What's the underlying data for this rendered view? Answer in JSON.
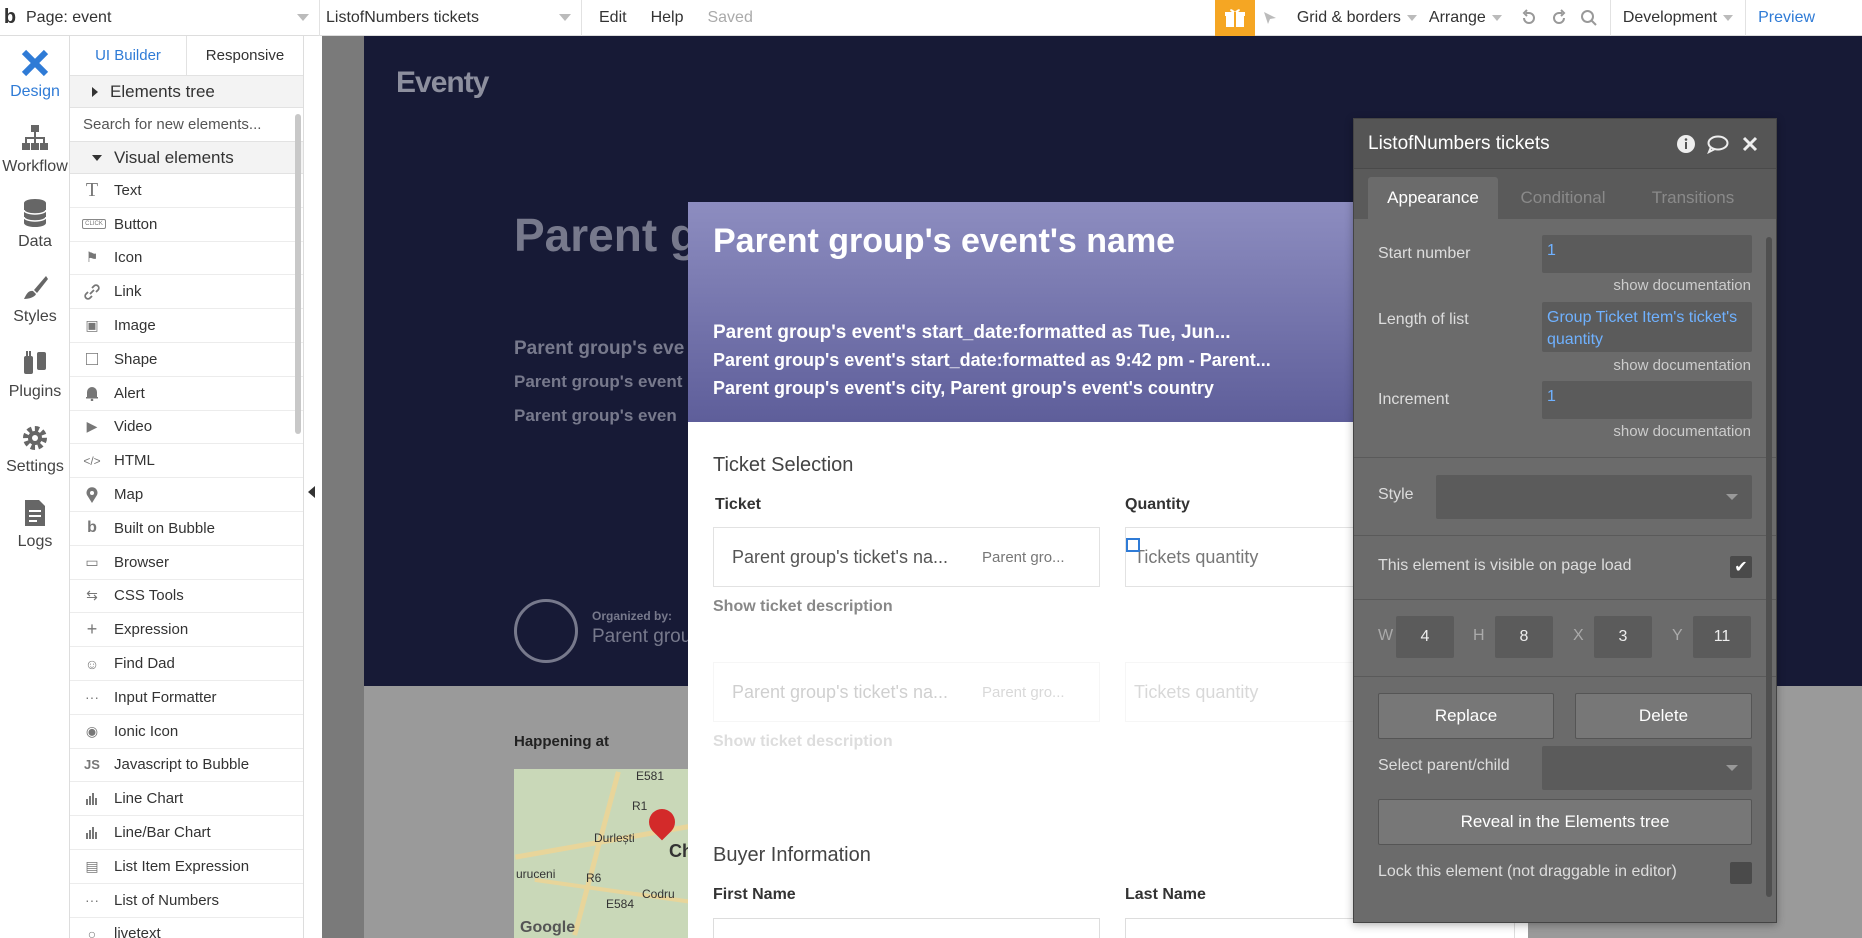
{
  "topbar": {
    "logo": "b",
    "page_select": "Page: event",
    "element_select": "ListofNumbers tickets",
    "edit": "Edit",
    "help": "Help",
    "saved": "Saved",
    "grid": "Grid & borders",
    "arrange": "Arrange",
    "environment": "Development",
    "preview": "Preview"
  },
  "leftnav": {
    "items": [
      {
        "label": "Design"
      },
      {
        "label": "Workflow"
      },
      {
        "label": "Data"
      },
      {
        "label": "Styles"
      },
      {
        "label": "Plugins"
      },
      {
        "label": "Settings"
      },
      {
        "label": "Logs"
      }
    ]
  },
  "elements_panel": {
    "tab_builder": "UI Builder",
    "tab_responsive": "Responsive",
    "tree_label": "Elements tree",
    "search_placeholder": "Search for new elements...",
    "visual_label": "Visual elements",
    "items": [
      {
        "label": "Text",
        "icon": "T"
      },
      {
        "label": "Button",
        "icon": "CLICK"
      },
      {
        "label": "Icon",
        "icon": "⚑"
      },
      {
        "label": "Link",
        "icon": "🔗"
      },
      {
        "label": "Image",
        "icon": "▣"
      },
      {
        "label": "Shape",
        "icon": "□"
      },
      {
        "label": "Alert",
        "icon": "🔔"
      },
      {
        "label": "Video",
        "icon": "▶"
      },
      {
        "label": "HTML",
        "icon": "</>"
      },
      {
        "label": "Map",
        "icon": "📍"
      },
      {
        "label": "Built on Bubble",
        "icon": "b"
      },
      {
        "label": "Browser",
        "icon": "▭"
      },
      {
        "label": "CSS Tools",
        "icon": "⇆"
      },
      {
        "label": "Expression",
        "icon": "+"
      },
      {
        "label": "Find Dad",
        "icon": "☺"
      },
      {
        "label": "Input Formatter",
        "icon": "···"
      },
      {
        "label": "Ionic Icon",
        "icon": "◉"
      },
      {
        "label": "Javascript to Bubble",
        "icon": "JS"
      },
      {
        "label": "Line Chart",
        "icon": "▮"
      },
      {
        "label": "Line/Bar Chart",
        "icon": "▮"
      },
      {
        "label": "List Item Expression",
        "icon": "▤"
      },
      {
        "label": "List of Numbers",
        "icon": "···"
      },
      {
        "label": "livetext",
        "icon": "○"
      }
    ]
  },
  "canvas": {
    "logo": "Eventy",
    "hero_title": "Parent g",
    "hero_line_1": "Parent group's eve",
    "hero_line_2": "Parent group's event",
    "hero_line_3": "Parent group's even",
    "organized_by": "Organized by:",
    "org_name": "Parent grou",
    "happening_at": "Happening at",
    "map_labels": [
      "E581",
      "R1",
      "Durlești",
      "Ch",
      "uruceni",
      "R6",
      "Codru",
      "E584",
      "Google"
    ]
  },
  "popup": {
    "title": "Parent group's event's name",
    "line_1": "Parent group's event's start_date:formatted as Tue, Jun...",
    "line_2": "Parent group's event's start_date:formatted as 9:42 pm - Parent...",
    "line_3": "Parent group's event's city, Parent group's event's country",
    "ticket_selection": "Ticket Selection",
    "ticket_label": "Ticket",
    "quantity_label": "Quantity",
    "ticket_name": "Parent group's ticket's na...",
    "ticket_price": "Parent gro...",
    "qty_placeholder": "Tickets quantity",
    "show_desc": "Show ticket description",
    "buyer_info": "Buyer Information",
    "first_name": "First Name",
    "last_name": "Last Name"
  },
  "property_editor": {
    "title": "ListofNumbers tickets",
    "tabs": [
      "Appearance",
      "Conditional",
      "Transitions"
    ],
    "start_number_label": "Start number",
    "start_number_value": "1",
    "length_label": "Length of list",
    "length_value": "Group Ticket Item's ticket's quantity",
    "increment_label": "Increment",
    "increment_value": "1",
    "show_doc": "show documentation",
    "style_label": "Style",
    "visible_label": "This element is visible on page load",
    "w_label": "W",
    "w_value": "4",
    "h_label": "H",
    "h_value": "8",
    "x_label": "X",
    "x_value": "3",
    "y_label": "Y",
    "y_value": "11",
    "replace": "Replace",
    "delete": "Delete",
    "select_parent": "Select parent/child",
    "reveal": "Reveal in the Elements tree",
    "lock": "Lock this element (not draggable in editor)"
  },
  "colors": {
    "accent": "#2f7bd6",
    "gift": "#f5a623",
    "hero": "#171a36",
    "popup_header": "#6f6fa8",
    "panel": "#6b6b6b"
  }
}
